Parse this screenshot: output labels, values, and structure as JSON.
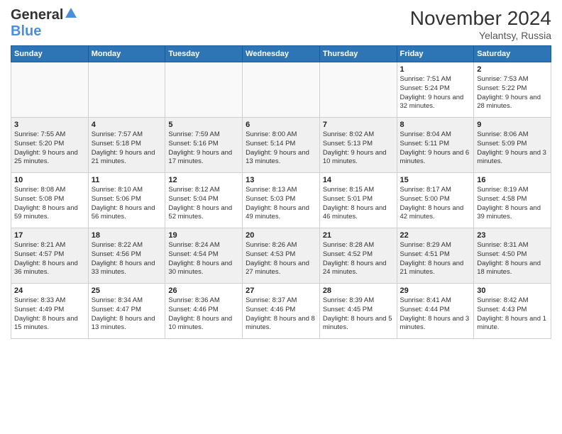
{
  "logo": {
    "general": "General",
    "blue": "Blue"
  },
  "title": "November 2024",
  "subtitle": "Yelantsy, Russia",
  "days_of_week": [
    "Sunday",
    "Monday",
    "Tuesday",
    "Wednesday",
    "Thursday",
    "Friday",
    "Saturday"
  ],
  "weeks": [
    [
      {
        "day": "",
        "info": ""
      },
      {
        "day": "",
        "info": ""
      },
      {
        "day": "",
        "info": ""
      },
      {
        "day": "",
        "info": ""
      },
      {
        "day": "",
        "info": ""
      },
      {
        "day": "1",
        "info": "Sunrise: 7:51 AM\nSunset: 5:24 PM\nDaylight: 9 hours and 32 minutes."
      },
      {
        "day": "2",
        "info": "Sunrise: 7:53 AM\nSunset: 5:22 PM\nDaylight: 9 hours and 28 minutes."
      }
    ],
    [
      {
        "day": "3",
        "info": "Sunrise: 7:55 AM\nSunset: 5:20 PM\nDaylight: 9 hours and 25 minutes."
      },
      {
        "day": "4",
        "info": "Sunrise: 7:57 AM\nSunset: 5:18 PM\nDaylight: 9 hours and 21 minutes."
      },
      {
        "day": "5",
        "info": "Sunrise: 7:59 AM\nSunset: 5:16 PM\nDaylight: 9 hours and 17 minutes."
      },
      {
        "day": "6",
        "info": "Sunrise: 8:00 AM\nSunset: 5:14 PM\nDaylight: 9 hours and 13 minutes."
      },
      {
        "day": "7",
        "info": "Sunrise: 8:02 AM\nSunset: 5:13 PM\nDaylight: 9 hours and 10 minutes."
      },
      {
        "day": "8",
        "info": "Sunrise: 8:04 AM\nSunset: 5:11 PM\nDaylight: 9 hours and 6 minutes."
      },
      {
        "day": "9",
        "info": "Sunrise: 8:06 AM\nSunset: 5:09 PM\nDaylight: 9 hours and 3 minutes."
      }
    ],
    [
      {
        "day": "10",
        "info": "Sunrise: 8:08 AM\nSunset: 5:08 PM\nDaylight: 8 hours and 59 minutes."
      },
      {
        "day": "11",
        "info": "Sunrise: 8:10 AM\nSunset: 5:06 PM\nDaylight: 8 hours and 56 minutes."
      },
      {
        "day": "12",
        "info": "Sunrise: 8:12 AM\nSunset: 5:04 PM\nDaylight: 8 hours and 52 minutes."
      },
      {
        "day": "13",
        "info": "Sunrise: 8:13 AM\nSunset: 5:03 PM\nDaylight: 8 hours and 49 minutes."
      },
      {
        "day": "14",
        "info": "Sunrise: 8:15 AM\nSunset: 5:01 PM\nDaylight: 8 hours and 46 minutes."
      },
      {
        "day": "15",
        "info": "Sunrise: 8:17 AM\nSunset: 5:00 PM\nDaylight: 8 hours and 42 minutes."
      },
      {
        "day": "16",
        "info": "Sunrise: 8:19 AM\nSunset: 4:58 PM\nDaylight: 8 hours and 39 minutes."
      }
    ],
    [
      {
        "day": "17",
        "info": "Sunrise: 8:21 AM\nSunset: 4:57 PM\nDaylight: 8 hours and 36 minutes."
      },
      {
        "day": "18",
        "info": "Sunrise: 8:22 AM\nSunset: 4:56 PM\nDaylight: 8 hours and 33 minutes."
      },
      {
        "day": "19",
        "info": "Sunrise: 8:24 AM\nSunset: 4:54 PM\nDaylight: 8 hours and 30 minutes."
      },
      {
        "day": "20",
        "info": "Sunrise: 8:26 AM\nSunset: 4:53 PM\nDaylight: 8 hours and 27 minutes."
      },
      {
        "day": "21",
        "info": "Sunrise: 8:28 AM\nSunset: 4:52 PM\nDaylight: 8 hours and 24 minutes."
      },
      {
        "day": "22",
        "info": "Sunrise: 8:29 AM\nSunset: 4:51 PM\nDaylight: 8 hours and 21 minutes."
      },
      {
        "day": "23",
        "info": "Sunrise: 8:31 AM\nSunset: 4:50 PM\nDaylight: 8 hours and 18 minutes."
      }
    ],
    [
      {
        "day": "24",
        "info": "Sunrise: 8:33 AM\nSunset: 4:49 PM\nDaylight: 8 hours and 15 minutes."
      },
      {
        "day": "25",
        "info": "Sunrise: 8:34 AM\nSunset: 4:47 PM\nDaylight: 8 hours and 13 minutes."
      },
      {
        "day": "26",
        "info": "Sunrise: 8:36 AM\nSunset: 4:46 PM\nDaylight: 8 hours and 10 minutes."
      },
      {
        "day": "27",
        "info": "Sunrise: 8:37 AM\nSunset: 4:46 PM\nDaylight: 8 hours and 8 minutes."
      },
      {
        "day": "28",
        "info": "Sunrise: 8:39 AM\nSunset: 4:45 PM\nDaylight: 8 hours and 5 minutes."
      },
      {
        "day": "29",
        "info": "Sunrise: 8:41 AM\nSunset: 4:44 PM\nDaylight: 8 hours and 3 minutes."
      },
      {
        "day": "30",
        "info": "Sunrise: 8:42 AM\nSunset: 4:43 PM\nDaylight: 8 hours and 1 minute."
      }
    ]
  ]
}
